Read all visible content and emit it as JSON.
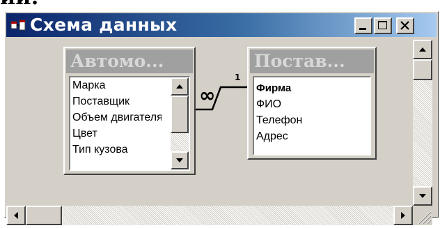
{
  "window": {
    "title": "Схема данных",
    "colors": {
      "titlebar_start": "#0a246a",
      "titlebar_end": "#a6caf0",
      "face": "#d4d0c8"
    },
    "controls": {
      "minimize_icon": "minimize-icon",
      "maximize_icon": "maximize-icon",
      "close_icon": "close-icon"
    }
  },
  "tables": [
    {
      "title": "Автомо...",
      "fields": [
        "Марка",
        "Поставщик",
        "Объем двигателя",
        "Цвет",
        "Тип кузова"
      ],
      "has_scrollbar": true
    },
    {
      "title": "Постав...",
      "fields": [
        "Фирма",
        "ФИО",
        "Телефон",
        "Адрес"
      ],
      "key_field": "Фирма",
      "has_scrollbar": false
    }
  ],
  "relationship": {
    "many_side_label": "∞",
    "one_side_label": "1"
  },
  "scrollbars": {
    "vertical": {
      "up_icon": "arrow-up-icon",
      "down_icon": "arrow-down-icon"
    },
    "horizontal": {
      "left_icon": "arrow-left-icon",
      "right_icon": "arrow-right-icon"
    },
    "resize_grip_icon": "resize-grip-icon"
  }
}
